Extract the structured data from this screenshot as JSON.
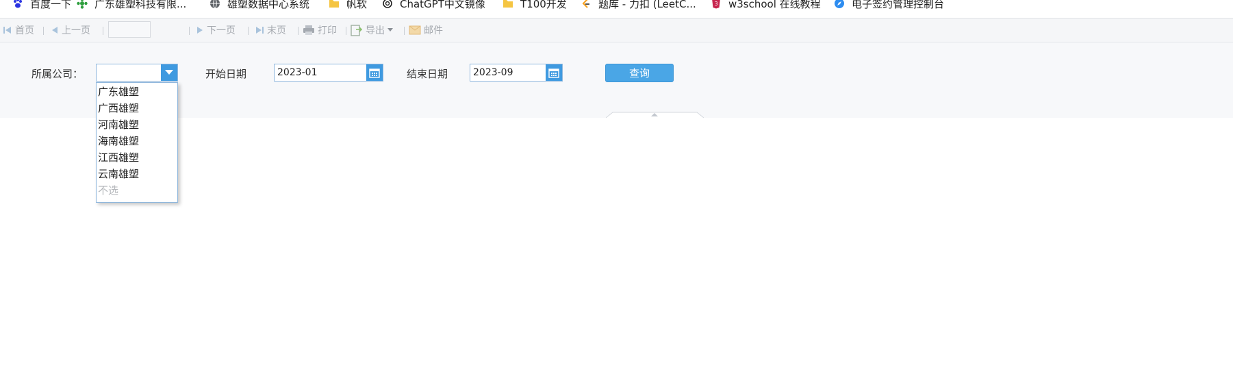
{
  "bookmarks": [
    {
      "label": "百度一下",
      "icon": "baidu-paw-icon",
      "color": "#2932e1"
    },
    {
      "label": "广东雄塑科技有限...",
      "icon": "green-flower-icon",
      "color": "#2e9e3e"
    },
    {
      "label": "雄塑数据中心系统",
      "icon": "globe-icon",
      "color": "#5f6368"
    },
    {
      "label": "帆软",
      "icon": "folder-icon",
      "color": "#f5c542"
    },
    {
      "label": "ChatGPT中文镜像",
      "icon": "openai-icon",
      "color": "#222222"
    },
    {
      "label": "T100开发",
      "icon": "folder-icon",
      "color": "#f5c542"
    },
    {
      "label": "题库 - 力扣 (LeetC...",
      "icon": "leetcode-icon",
      "color": "#f89f1b"
    },
    {
      "label": "w3school 在线教程",
      "icon": "w3school-icon",
      "color": "#c7254e"
    },
    {
      "label": "电子签约管理控制台",
      "icon": "compass-icon",
      "color": "#2d8cf0"
    }
  ],
  "toolbar": {
    "first": "首页",
    "prev": "上一页",
    "page_value": "",
    "next": "下一页",
    "last": "末页",
    "print": "打印",
    "export": "导出",
    "mail": "邮件"
  },
  "filters": {
    "company_label": "所属公司：",
    "company_value": "",
    "start_label": "开始日期",
    "start_value": "2023-01",
    "end_label": "结束日期",
    "end_value": "2023-09",
    "query_label": "查询"
  },
  "dropdown": {
    "options": [
      "广东雄塑",
      "广西雄塑",
      "河南雄塑",
      "海南雄塑",
      "江西雄塑",
      "云南雄塑"
    ],
    "none_option": "不选"
  },
  "colors": {
    "accent": "#3f9ae0",
    "button": "#4aa6e6",
    "toolbar_text": "#a4a8ae",
    "muted_text": "#b3b6ba"
  }
}
